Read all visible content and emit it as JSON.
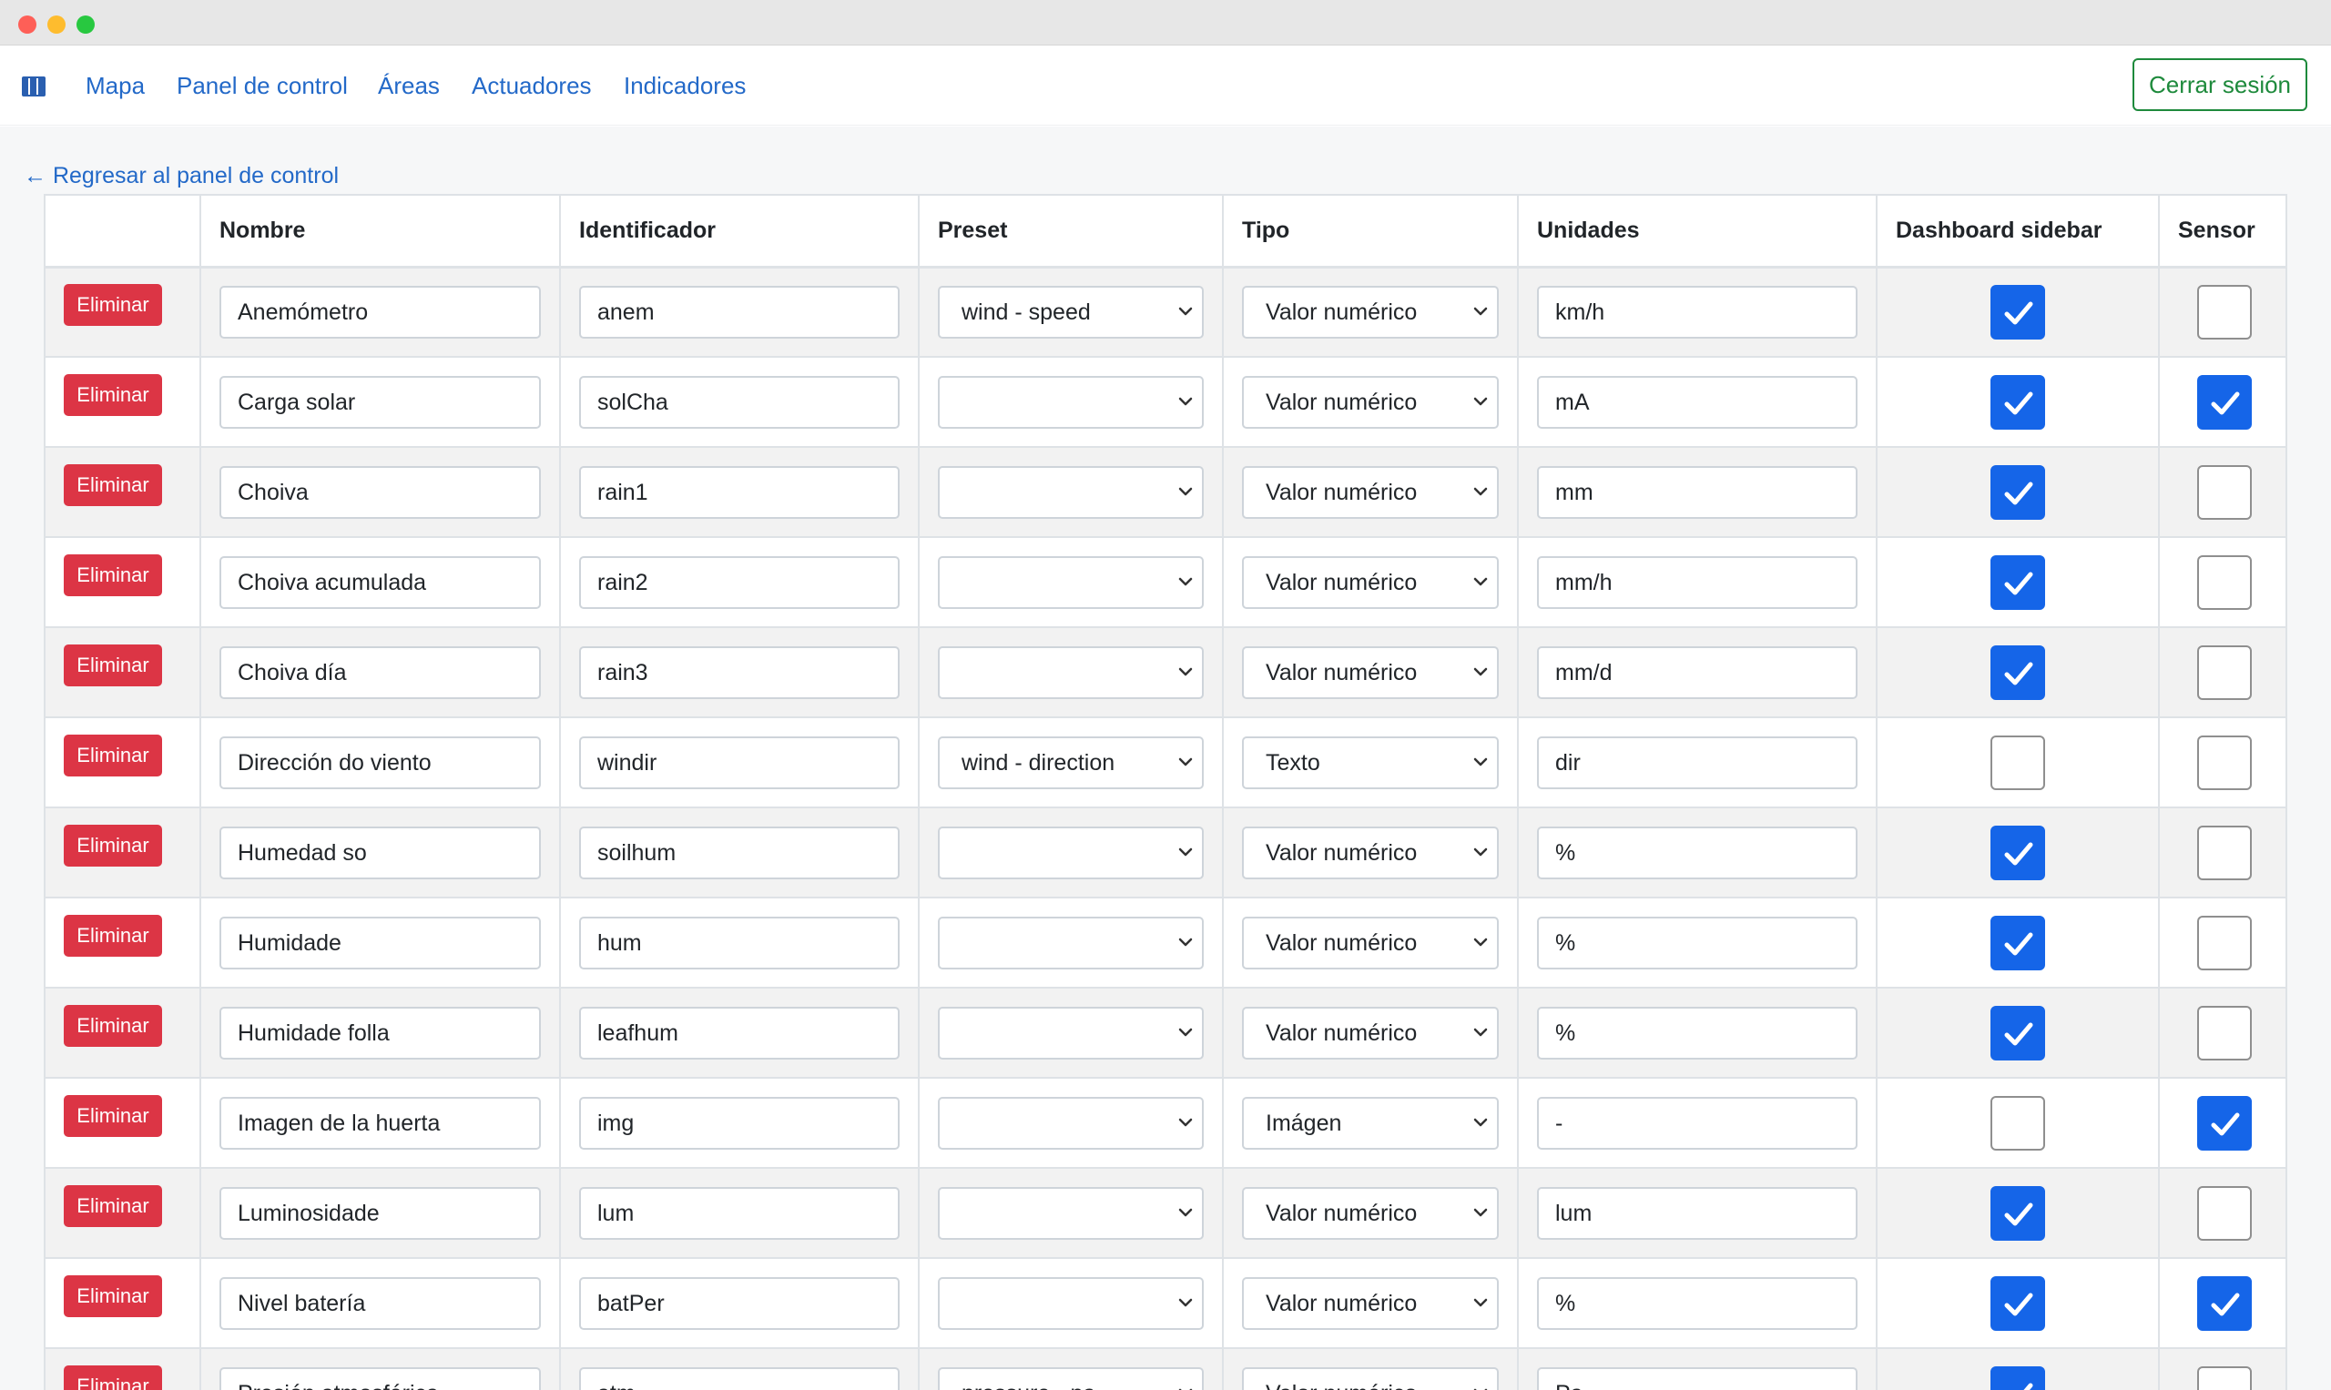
{
  "nav": {
    "links": [
      "Mapa",
      "Panel de control",
      "Áreas",
      "Actuadores",
      "Indicadores"
    ],
    "logout": "Cerrar sesión"
  },
  "back_link": "← Regresar al panel de control",
  "table": {
    "headers": [
      "",
      "Nombre",
      "Identificador",
      "Preset",
      "Tipo",
      "Unidades",
      "Dashboard sidebar",
      "Sensor"
    ],
    "delete_label": "Eliminar",
    "rows": [
      {
        "name": "Anemómetro",
        "id": "anem",
        "preset": "wind - speed",
        "type": "Valor numérico",
        "units": "km/h",
        "sidebar": true,
        "sensor": false
      },
      {
        "name": "Carga solar",
        "id": "solCha",
        "preset": "",
        "type": "Valor numérico",
        "units": "mA",
        "sidebar": true,
        "sensor": true
      },
      {
        "name": "Choiva",
        "id": "rain1",
        "preset": "",
        "type": "Valor numérico",
        "units": "mm",
        "sidebar": true,
        "sensor": false
      },
      {
        "name": "Choiva acumulada",
        "id": "rain2",
        "preset": "",
        "type": "Valor numérico",
        "units": "mm/h",
        "sidebar": true,
        "sensor": false
      },
      {
        "name": "Choiva día",
        "id": "rain3",
        "preset": "",
        "type": "Valor numérico",
        "units": "mm/d",
        "sidebar": true,
        "sensor": false
      },
      {
        "name": "Dirección do viento",
        "id": "windir",
        "preset": "wind - direction",
        "type": "Texto",
        "units": "dir",
        "sidebar": false,
        "sensor": false
      },
      {
        "name": "Humedad so",
        "id": "soilhum",
        "preset": "",
        "type": "Valor numérico",
        "units": "%",
        "sidebar": true,
        "sensor": false
      },
      {
        "name": "Humidade",
        "id": "hum",
        "preset": "",
        "type": "Valor numérico",
        "units": "%",
        "sidebar": true,
        "sensor": false
      },
      {
        "name": "Humidade folla",
        "id": "leafhum",
        "preset": "",
        "type": "Valor numérico",
        "units": "%",
        "sidebar": true,
        "sensor": false
      },
      {
        "name": "Imagen de la huerta",
        "id": "img",
        "preset": "",
        "type": "Imágen",
        "units": "-",
        "sidebar": false,
        "sensor": true
      },
      {
        "name": "Luminosidade",
        "id": "lum",
        "preset": "",
        "type": "Valor numérico",
        "units": "lum",
        "sidebar": true,
        "sensor": false
      },
      {
        "name": "Nivel batería",
        "id": "batPer",
        "preset": "",
        "type": "Valor numérico",
        "units": "%",
        "sidebar": true,
        "sensor": true
      },
      {
        "name": "Presión atmosférica",
        "id": "atm",
        "preset": "pressure - pa",
        "type": "Valor numérico",
        "units": "Pa",
        "sidebar": true,
        "sensor": false
      }
    ]
  },
  "colors": {
    "link": "#2369c8",
    "delete": "#dc3545",
    "logout": "#1e8a3c",
    "checkbox_checked": "#1565e8"
  }
}
